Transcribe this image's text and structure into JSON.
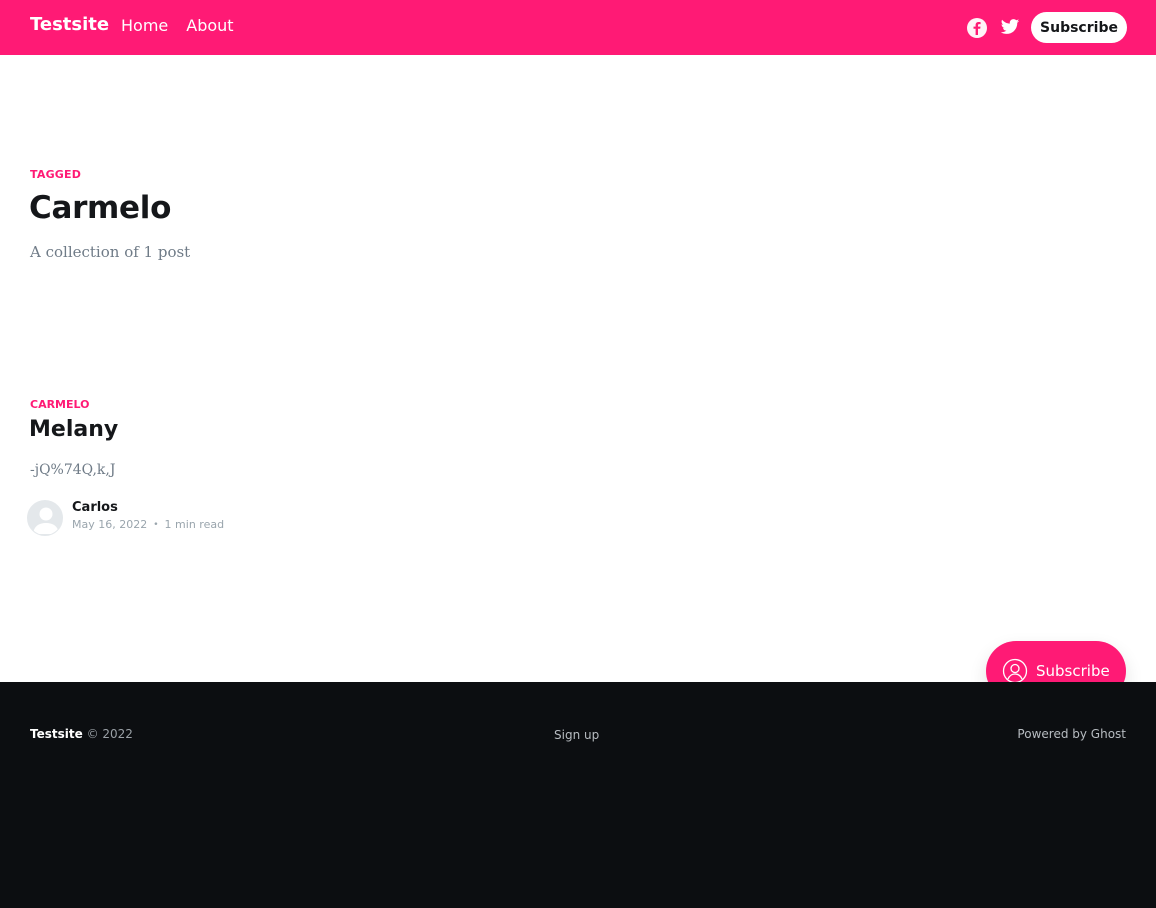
{
  "header": {
    "brand": "Testsite",
    "nav": [
      {
        "label": "Home"
      },
      {
        "label": "About"
      }
    ],
    "subscribe_label": "Subscribe",
    "accent_color": "#ff1a75"
  },
  "tag": {
    "label": "TAGGED",
    "name": "Carmelo",
    "description": "A collection of 1 post"
  },
  "posts": [
    {
      "tag": "CARMELO",
      "title": "Melany",
      "excerpt": "-jQ%74Q,k,J",
      "author": "Carlos",
      "date": "May 16, 2022",
      "reading_time": "1 min read"
    }
  ],
  "portal": {
    "label": "Subscribe"
  },
  "footer": {
    "site": "Testsite",
    "copyright": "© 2022",
    "signup": "Sign up",
    "powered": "Powered by Ghost",
    "background": "#0c0e11"
  },
  "icons": [
    "facebook-icon",
    "twitter-icon",
    "user-circle-icon",
    "avatar-placeholder-icon"
  ]
}
